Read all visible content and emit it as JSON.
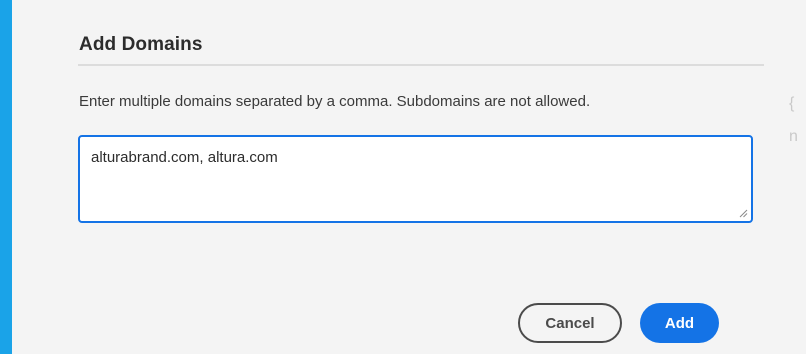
{
  "dialog": {
    "title": "Add Domains",
    "description": "Enter multiple domains separated by a comma. Subdomains are not allowed.",
    "domains_input": {
      "value": "alturabrand.com, altura.com",
      "placeholder": ""
    },
    "buttons": {
      "cancel_label": "Cancel",
      "add_label": "Add"
    }
  },
  "background_glyphs": {
    "glyph_1": "{",
    "glyph_2": "n"
  },
  "colors": {
    "background": "#1aa3e8",
    "dialog": "#f4f4f4",
    "accent": "#1473e6",
    "text": "#2c2c2c",
    "secondary_button": "#4b4b4b"
  }
}
